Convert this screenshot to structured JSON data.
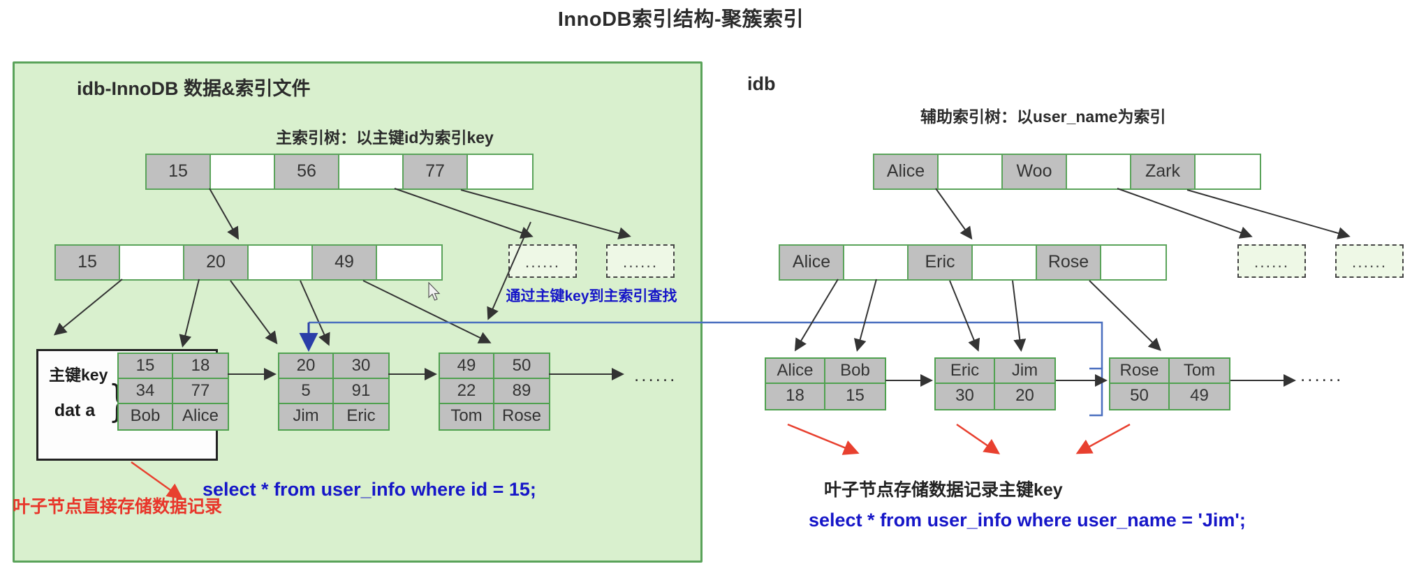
{
  "title": "InnoDB索引结构-聚簇索引",
  "left_panel": {
    "heading": "idb-InnoDB 数据&索引文件",
    "subheading": "主索引树：以主键id为索引key",
    "root_node": [
      "15",
      "",
      "56",
      "",
      "77",
      ""
    ],
    "level2_node": [
      "15",
      "",
      "20",
      "",
      "49",
      ""
    ],
    "dashed_nodes": [
      "......",
      "......"
    ],
    "leaf_labels": {
      "key": "主键key",
      "data": "dat a"
    },
    "leaves": [
      {
        "keys": [
          "15",
          "18"
        ],
        "data1": [
          "34",
          "77"
        ],
        "data2": [
          "Bob",
          "Alice"
        ]
      },
      {
        "keys": [
          "20",
          "30"
        ],
        "data1": [
          "5",
          "91"
        ],
        "data2": [
          "Jim",
          "Eric"
        ]
      },
      {
        "keys": [
          "49",
          "50"
        ],
        "data1": [
          "22",
          "89"
        ],
        "data2": [
          "Tom",
          "Rose"
        ]
      }
    ],
    "leaf_tail_ellipsis": "......",
    "annotation_lookup": "通过主键key到主索引查找",
    "sql": "select  * from user_info  where id = 15;",
    "note_leaf": "叶子节点直接存储数据记录"
  },
  "right_panel": {
    "heading": "idb",
    "subheading": "辅助索引树：以user_name为索引",
    "root_node": [
      "Alice",
      "",
      "Woo",
      "",
      "Zark",
      ""
    ],
    "level2_node": [
      "Alice",
      "",
      "Eric",
      "",
      "Rose",
      ""
    ],
    "dashed_nodes": [
      "......",
      "......"
    ],
    "leaves": [
      {
        "names": [
          "Alice",
          "Bob"
        ],
        "keys": [
          "18",
          "15"
        ]
      },
      {
        "names": [
          "Eric",
          "Jim"
        ],
        "keys": [
          "30",
          "20"
        ]
      },
      {
        "names": [
          "Rose",
          "Tom"
        ],
        "keys": [
          "50",
          "49"
        ]
      }
    ],
    "leaf_tail_ellipsis": "......",
    "note_leaf": "叶子节点存储数据记录主键key",
    "sql": "select  * from user_info  where user_name = 'Jim';"
  },
  "colors": {
    "left_bg": "#d9f0ce",
    "right_bg": "#d4f0e4",
    "panel_border": "#5aa35a",
    "cell_fill": "#c0c0c0",
    "blue_text": "#1616c8",
    "red_text": "#e8352a",
    "blue_line": "#4a6fbf",
    "red_arrow": "#e8402f"
  }
}
